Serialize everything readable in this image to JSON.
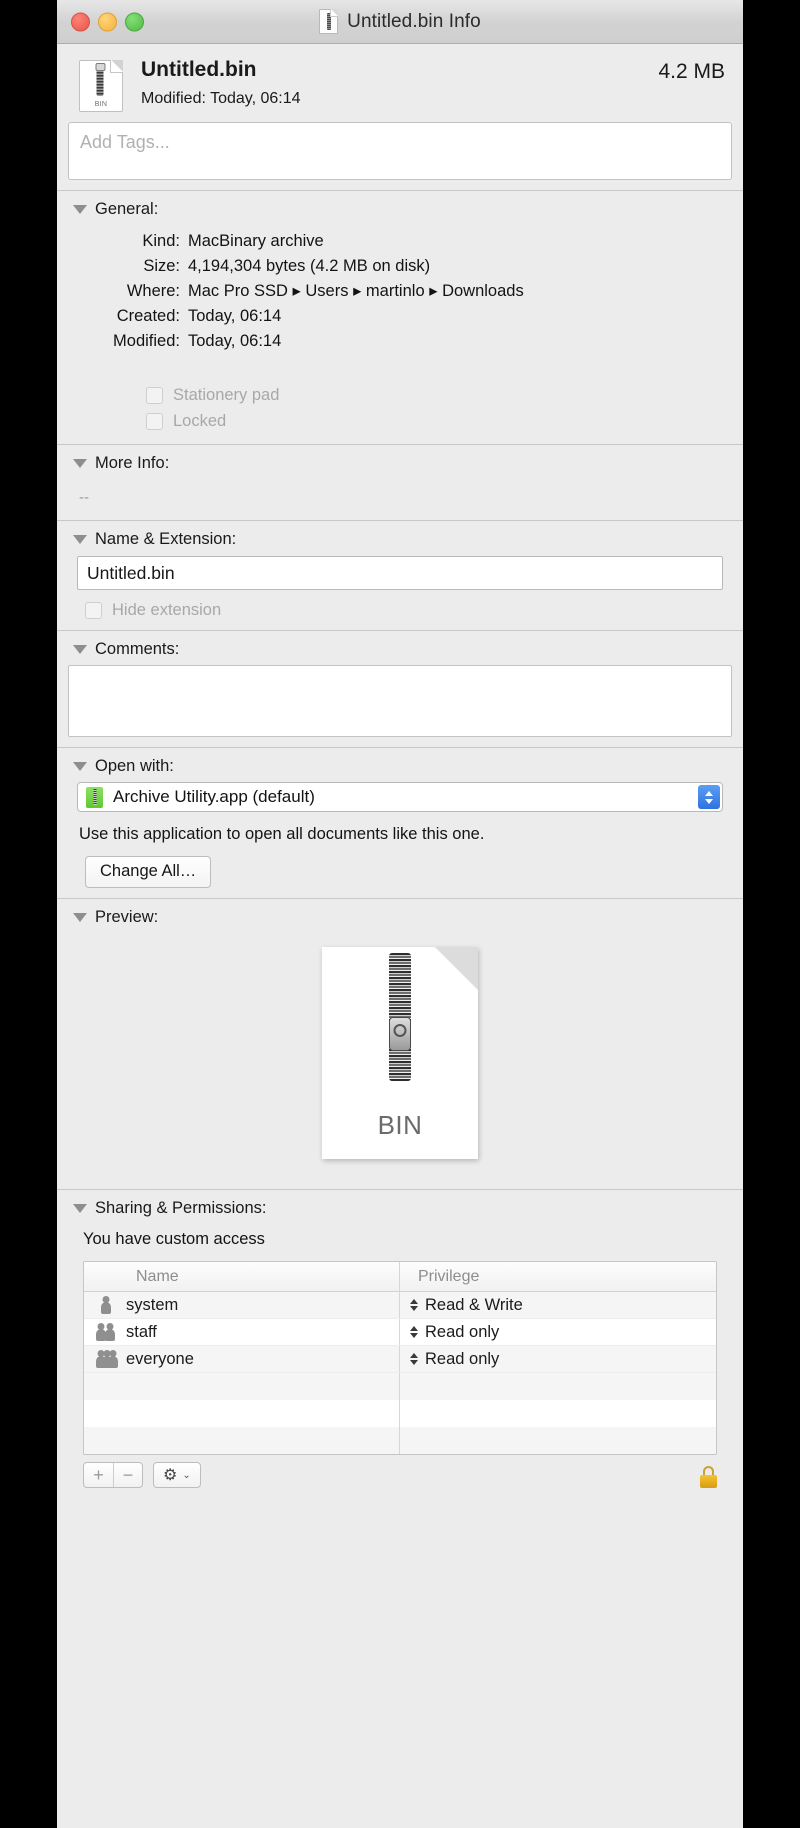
{
  "window": {
    "title": "Untitled.bin Info",
    "traffic_lights": [
      "close",
      "minimize",
      "zoom"
    ]
  },
  "header": {
    "file_name": "Untitled.bin",
    "modified_label": "Modified:",
    "modified_value": "Today, 06:14",
    "size_badge": "4.2 MB",
    "icon_label": "BIN"
  },
  "tags": {
    "placeholder": "Add Tags..."
  },
  "general": {
    "section_title": "General:",
    "rows": [
      {
        "key": "Kind:",
        "value": "MacBinary archive"
      },
      {
        "key": "Size:",
        "value": "4,194,304 bytes (4.2 MB on disk)"
      },
      {
        "key": "Where:",
        "value": "Mac Pro SSD ▸ Users ▸ martinlo ▸ Downloads"
      },
      {
        "key": "Created:",
        "value": "Today, 06:14"
      },
      {
        "key": "Modified:",
        "value": "Today, 06:14"
      }
    ],
    "checkboxes": [
      {
        "label": "Stationery pad",
        "checked": false
      },
      {
        "label": "Locked",
        "checked": false
      }
    ]
  },
  "more_info": {
    "section_title": "More Info:",
    "body": "--"
  },
  "name_extension": {
    "section_title": "Name & Extension:",
    "value": "Untitled.bin",
    "hide_extension_label": "Hide extension",
    "hide_extension_checked": false
  },
  "comments": {
    "section_title": "Comments:",
    "value": ""
  },
  "open_with": {
    "section_title": "Open with:",
    "selected": "Archive Utility.app (default)",
    "note": "Use this application to open all documents like this one.",
    "change_all_label": "Change All…"
  },
  "preview": {
    "section_title": "Preview:",
    "doc_label": "BIN"
  },
  "sharing": {
    "section_title": "Sharing & Permissions:",
    "access_note": "You have custom access",
    "columns": [
      "Name",
      "Privilege"
    ],
    "rows": [
      {
        "name": "system",
        "privilege": "Read & Write",
        "icon": "single-user-icon"
      },
      {
        "name": "staff",
        "privilege": "Read only",
        "icon": "dual-user-icon"
      },
      {
        "name": "everyone",
        "privilege": "Read only",
        "icon": "trio-user-icon"
      }
    ],
    "footer": {
      "add_label": "+",
      "remove_label": "−",
      "gear_label": "⚙",
      "gear_caret": "⌄",
      "lock_state": "unlocked"
    }
  },
  "colors": {
    "window_bg": "#ececec",
    "field_bg": "#ffffff",
    "accent_blue": "#2f72e0",
    "app_icon_green": "#5fc733",
    "lock_gold": "#d99b12",
    "close_red": "#ec6459",
    "min_yellow": "#f5bd4f",
    "max_green": "#61c454"
  }
}
